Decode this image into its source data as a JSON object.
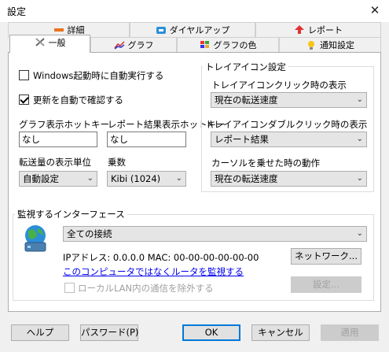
{
  "window": {
    "title": "設定",
    "close_glyph": "✕"
  },
  "tabs_row_back": [
    {
      "label": "詳細",
      "icon": "detail-icon"
    },
    {
      "label": "ダイヤルアップ",
      "icon": "phone-icon"
    },
    {
      "label": "レポート",
      "icon": "report-icon"
    }
  ],
  "tabs_row_front": [
    {
      "label": "一般",
      "icon": "tools-icon",
      "active": true
    },
    {
      "label": "グラフ",
      "icon": "graph-icon"
    },
    {
      "label": "グラフの色",
      "icon": "palette-icon"
    },
    {
      "label": "通知設定",
      "icon": "bulb-icon"
    }
  ],
  "general": {
    "autostart": {
      "label": "Windows起動時に自動実行する",
      "checked": false
    },
    "autoupdate": {
      "label": "更新を自動で確認する",
      "checked": true
    },
    "graph_hotkey": {
      "label": "グラフ表示ホットキー",
      "value": "なし"
    },
    "report_hotkey": {
      "label": "レポート結果表示ホットキー",
      "value": "なし"
    },
    "transfer_unit": {
      "label": "転送量の表示単位",
      "value": "自動設定"
    },
    "multiplier": {
      "label": "乗数",
      "value": "Kibi (1024)"
    }
  },
  "tray": {
    "title": "トレイアイコン設定",
    "click": {
      "label": "トレイアイコンクリック時の表示",
      "value": "現在の転送速度"
    },
    "dblclick": {
      "label": "トレイアイコンダブルクリック時の表示",
      "value": "レポート結果"
    },
    "hover": {
      "label": "カーソルを乗せた時の動作",
      "value": "現在の転送速度"
    }
  },
  "interface": {
    "title": "監視するインターフェース",
    "selected": "全ての接続",
    "ip_line": "IPアドレス: 0.0.0.0   MAC: 00-00-00-00-00-00",
    "router_link": "このコンピュータではなくルータを監視する",
    "network_button": "ネットワーク...",
    "settings_button": "設定...",
    "exclude_lan": {
      "label": "ローカルLAN内の通信を除外する",
      "checked": false
    }
  },
  "footer": {
    "help": "ヘルプ",
    "password": "パスワード(P)",
    "ok": "OK",
    "cancel": "キャンセル",
    "apply": "適用"
  },
  "colors": {
    "accent": "#0078d7",
    "link": "#0000ee"
  }
}
